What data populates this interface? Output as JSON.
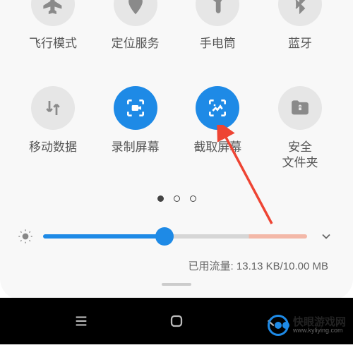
{
  "toggles": {
    "airplane": "飞行模式",
    "location": "定位服务",
    "flashlight": "手电筒",
    "bluetooth": "蓝牙",
    "mobile_data": "移动数据",
    "record_screen": "录制屏幕",
    "screenshot": "截取屏幕",
    "secure_folder": "安全\n文件夹"
  },
  "data_usage": {
    "label": "已用流量:",
    "used": "13.13 KB",
    "separator": "/",
    "total": "10.00 MB"
  },
  "watermark": {
    "name": "快眼游戏网",
    "url": "www.kyliying.com"
  },
  "colors": {
    "accent": "#1e8ae6",
    "inactive": "#e6e6e6"
  }
}
